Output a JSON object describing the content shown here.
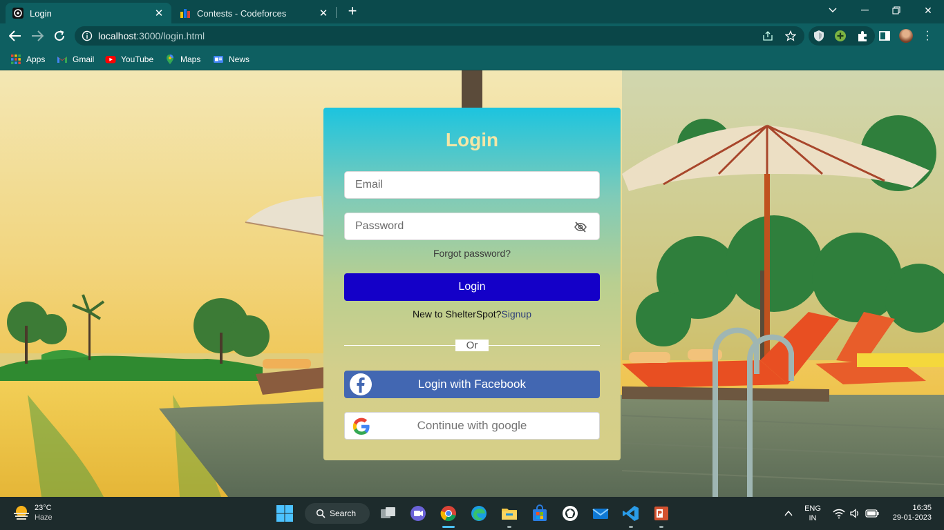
{
  "browser": {
    "tabs": [
      {
        "title": "Login",
        "active": true
      },
      {
        "title": "Contests - Codeforces",
        "active": false
      }
    ],
    "url_host": "localhost",
    "url_path": ":3000/login.html",
    "bookmarks": [
      "Apps",
      "Gmail",
      "YouTube",
      "Maps",
      "News"
    ]
  },
  "login": {
    "title": "Login",
    "email_placeholder": "Email",
    "password_placeholder": "Password",
    "forgot": "Forgot password?",
    "login_button": "Login",
    "new_user_text": "New to ShelterSpot?",
    "signup_link": "Signup",
    "or_text": "Or",
    "facebook_button": "Login with Facebook",
    "google_button": "Continue with google"
  },
  "taskbar": {
    "temperature": "23°C",
    "condition": "Haze",
    "search_label": "Search",
    "lang1": "ENG",
    "lang2": "IN",
    "time": "16:35",
    "date": "29-01-2023"
  },
  "colors": {
    "chrome_dark": "#0b4a4c",
    "chrome": "#0e5f61",
    "login_button": "#1400c8",
    "facebook": "#4267b2",
    "card_top": "#1cc4df",
    "card_bottom": "#d6cf87",
    "title": "#f3e6a6"
  }
}
